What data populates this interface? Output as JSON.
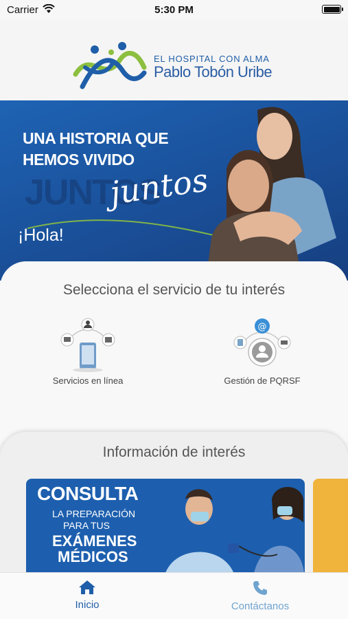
{
  "status_bar": {
    "carrier": "Carrier",
    "time": "5:30 PM"
  },
  "header": {
    "tagline": "EL HOSPITAL CON ALMA",
    "brand": "Pablo Tobón Uribe"
  },
  "hero": {
    "headline": "UNA HISTORIA QUE HEMOS VIVIDO",
    "script_word": "juntos",
    "ghost_word": "JUNTOS",
    "greeting": "¡Hola!"
  },
  "services": {
    "title": "Selecciona el servicio de tu interés",
    "items": [
      {
        "label": "Servicios en línea",
        "icon": "online-services-icon"
      },
      {
        "label": "Gestión de PQRSF",
        "icon": "pqrsf-icon"
      }
    ]
  },
  "info": {
    "title": "Información de interés",
    "promo": {
      "kicker": "CONSULTA",
      "line1": "LA PREPARACIÓN",
      "line2": "PARA TUS",
      "line3": "EXÁMENES",
      "line4": "MÉDICOS"
    }
  },
  "tabs": [
    {
      "label": "Inicio",
      "icon": "home-icon",
      "active": true
    },
    {
      "label": "Contáctanos",
      "icon": "phone-icon",
      "active": false
    }
  ],
  "colors": {
    "brand_blue": "#1f5ea8",
    "brand_green": "#8cbf3f",
    "hero_blue": "#1a4f98",
    "tab_inactive": "#6fa4cf"
  }
}
